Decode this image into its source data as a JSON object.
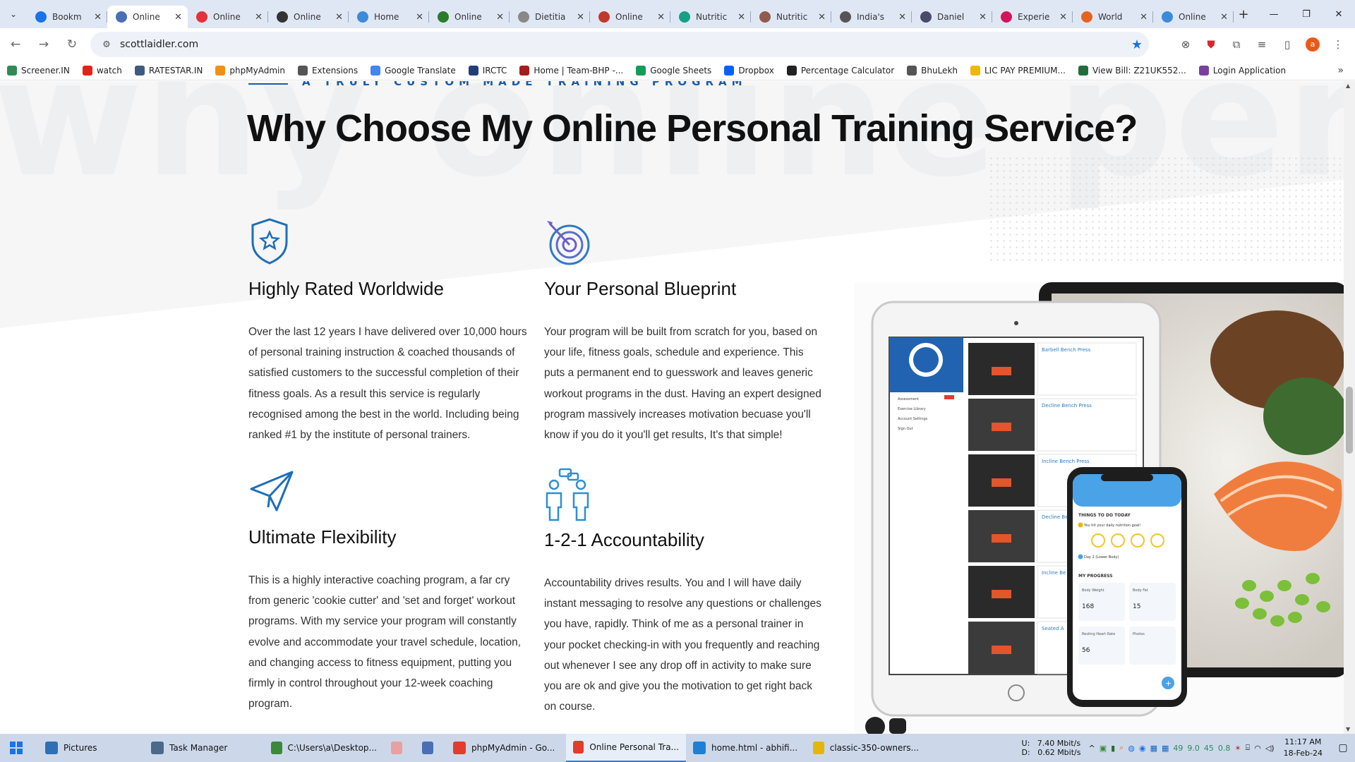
{
  "browser": {
    "tabs": [
      {
        "title": "Bookm",
        "icon": "star-icon",
        "color": "#1a73e8",
        "active": false
      },
      {
        "title": "Online",
        "icon": "chrome-icon",
        "color": "#4a6fb5",
        "active": true
      },
      {
        "title": "Online",
        "icon": "red-circle-icon",
        "color": "#e2333a",
        "active": false
      },
      {
        "title": "Online",
        "icon": "dark-logo-icon",
        "color": "#333333",
        "active": false
      },
      {
        "title": "Home",
        "icon": "blue-logo-icon",
        "color": "#3d8ad9",
        "active": false
      },
      {
        "title": "Online",
        "icon": "wf-logo-icon",
        "color": "#2c7a2c",
        "active": false
      },
      {
        "title": "Dietitia",
        "icon": "page-icon",
        "color": "#888888",
        "active": false
      },
      {
        "title": "Online",
        "icon": "pdf-icon",
        "color": "#c0392b",
        "active": false
      },
      {
        "title": "Nutritic",
        "icon": "leaf-icon",
        "color": "#16a085",
        "active": false
      },
      {
        "title": "Nutritic",
        "icon": "person-icon",
        "color": "#8e5d4b",
        "active": false
      },
      {
        "title": "India's",
        "icon": "map-pin-icon",
        "color": "#555555",
        "active": false
      },
      {
        "title": "Daniel",
        "icon": "globe-icon",
        "color": "#4a4a6a",
        "active": false
      },
      {
        "title": "Experie",
        "icon": "red-square-icon",
        "color": "#d4145a",
        "active": false
      },
      {
        "title": "World",
        "icon": "upi-icon",
        "color": "#e6621f",
        "active": false
      },
      {
        "title": "Online",
        "icon": "doc-icon",
        "color": "#3d8ad9",
        "active": false
      }
    ],
    "url": "scottlaidler.com",
    "profile_initial": "a",
    "bookmarks": [
      {
        "label": "Screener.IN",
        "color": "#2e8b57"
      },
      {
        "label": "watch",
        "color": "#e62117"
      },
      {
        "label": "RATESTAR.IN",
        "color": "#3d5a80"
      },
      {
        "label": "phpMyAdmin",
        "color": "#f29111"
      },
      {
        "label": "Extensions",
        "color": "#555555"
      },
      {
        "label": "Google Translate",
        "color": "#4285f4"
      },
      {
        "label": "IRCTC",
        "color": "#213d77"
      },
      {
        "label": "Home | Team-BHP -...",
        "color": "#a61b1b"
      },
      {
        "label": "Google Sheets",
        "color": "#0f9d58"
      },
      {
        "label": "Dropbox",
        "color": "#0061fe"
      },
      {
        "label": "Percentage Calculator",
        "color": "#222222"
      },
      {
        "label": "BhuLekh",
        "color": "#555555"
      },
      {
        "label": "LIC PAY PREMIUM...",
        "color": "#f2b705"
      },
      {
        "label": "View Bill: Z21UK552...",
        "color": "#1f6f3a"
      },
      {
        "label": "Login Application",
        "color": "#7b3fa0"
      }
    ]
  },
  "page": {
    "watermark": "why online personal tr",
    "eyebrow": "A TRULY CUSTOM MADE TRAINING PROGRAM",
    "headline": "Why Choose My Online Personal Training Service?",
    "features": [
      {
        "title": "Highly Rated Worldwide",
        "text": "Over the last 12 years I have delivered over 10,000 hours of personal training instruction & coached thousands of satisfied customers to the successful completion of their fitness goals. As a result this service is regularly recognised among the best in the world. Including being ranked #1 by the institute of personal trainers."
      },
      {
        "title": "Your Personal Blueprint",
        "text": "Your program will be built from scratch for you, based on your life, fitness goals, schedule and experience. This puts a permanent end to guesswork and leaves generic workout programs in the dust. Having an expert designed program massively increases motivation becuase you'll know if you do it you'll get results, It's that simple!"
      },
      {
        "title": "Ultimate Flexibility",
        "text": "This is a highly interactive coaching program, a far cry from generic 'cookie cutter' and 'set and forget' workout programs. With my service your program will constantly evolve and accommodate your travel schedule, location, and changing access to fitness equipment, putting you firmly in control throughout your 12-week coaching program."
      },
      {
        "title": "1-2-1 Accountability",
        "text": "Accountability drives results. You and I will have daily instant messaging to resolve any questions or challenges you have, rapidly. Think of me as a personal trainer in your pocket checking-in with you frequently and reaching out whenever I see any drop off in activity to make sure you are ok and give you the motivation to get right back on course."
      }
    ],
    "mockup": {
      "exercises": [
        "Barbell Bench Press",
        "Decline Bench Press",
        "Incline Bench Press",
        "Decline Be",
        "Incline Be",
        "Seated A"
      ],
      "sidebar_items": [
        "Assessment",
        "Exercise Library",
        "Account Settings",
        "Sign Out"
      ],
      "phone": {
        "heading": "THINGS TO DO TODAY",
        "task1": "You hit your daily nutrition goal!",
        "task2": "Day 2 (Lower Body)",
        "progress_heading": "MY PROGRESS",
        "cards": [
          {
            "label": "Body Weight",
            "value": "168"
          },
          {
            "label": "Body Fat",
            "value": "15"
          },
          {
            "label": "Resting Heart Rate",
            "value": "56"
          },
          {
            "label": "Photos",
            "value": ""
          }
        ]
      }
    }
  },
  "taskbar": {
    "items": [
      {
        "label": "Pictures",
        "color": "#2f6fb5",
        "active": false
      },
      {
        "label": "Task Manager",
        "color": "#4a6a8a",
        "active": false
      },
      {
        "label": "C:\\Users\\a\\Desktop...",
        "color": "#3a8a3a",
        "active": false
      },
      {
        "label": "",
        "color": "#e8a0a0",
        "active": false
      },
      {
        "label": "",
        "color": "#4a6fb5",
        "active": false
      },
      {
        "label": "phpMyAdmin - Go...",
        "color": "#e33b2e",
        "active": false
      },
      {
        "label": "Online Personal Tra...",
        "color": "#e33b2e",
        "active": true
      },
      {
        "label": "home.html - abhifi...",
        "color": "#1f7fd4",
        "active": false
      },
      {
        "label": "classic-350-owners...",
        "color": "#e5b50c",
        "active": false
      }
    ],
    "net_up": "U:",
    "net_up_value": "7.40 Mbit/s",
    "net_down": "D:",
    "net_down_value": "0.62 Mbit/s",
    "tray_values": [
      "49",
      "9.0",
      "45",
      "0.8"
    ],
    "time": "11:17 AM",
    "date": "18-Feb-24"
  }
}
